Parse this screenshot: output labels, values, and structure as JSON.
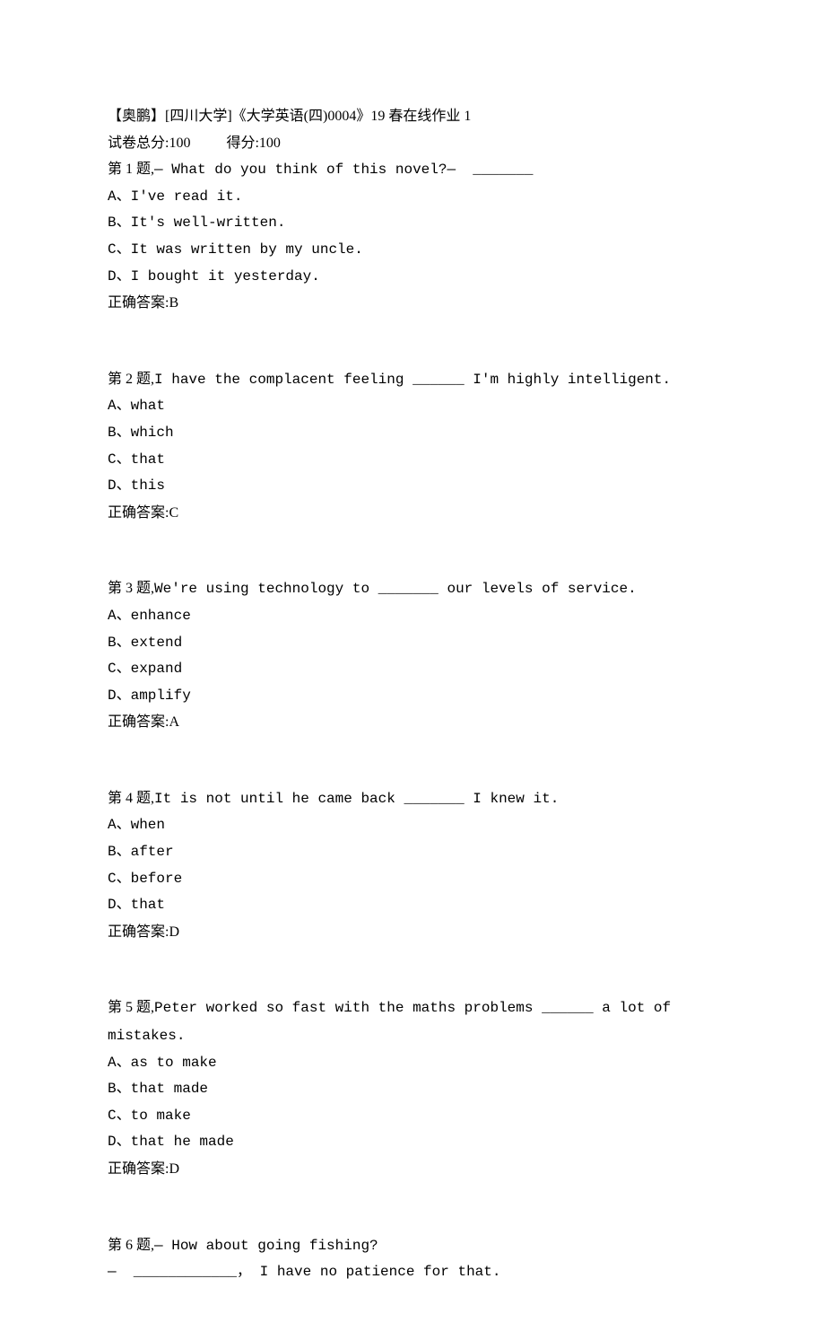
{
  "header": {
    "title": "【奥鹏】[四川大学]《大学英语(四)0004》19 春在线作业 1",
    "total_label": "试卷总分:",
    "total_value": "100",
    "score_label": "得分:",
    "score_value": "100"
  },
  "questions": [
    {
      "num": "第 1 题,",
      "text": "— What do you think of this novel?—  _______",
      "options": [
        "A、I've read it.",
        "B、It's well-written.",
        "C、It was written by my uncle.",
        "D、I bought it yesterday."
      ],
      "answer_label": "正确答案:",
      "answer": "B"
    },
    {
      "num": "第 2 题,",
      "text": "I have the complacent feeling ______ I'm highly intelligent.",
      "options": [
        "A、what",
        "B、which",
        "C、that",
        "D、this"
      ],
      "answer_label": "正确答案:",
      "answer": "C"
    },
    {
      "num": "第 3 题,",
      "text": "We're using technology to _______ our levels of service.",
      "options": [
        "A、enhance",
        "B、extend",
        "C、expand",
        "D、amplify"
      ],
      "answer_label": "正确答案:",
      "answer": "A"
    },
    {
      "num": "第 4 题,",
      "text": "It is not until he came back _______ I knew it.",
      "options": [
        "A、when",
        "B、after",
        "C、before",
        "D、that"
      ],
      "answer_label": "正确答案:",
      "answer": "D"
    },
    {
      "num": "第 5 题,",
      "text": "Peter worked so fast with the maths problems ______ a lot of mistakes.",
      "options": [
        "A、as to make",
        "B、that made",
        "C、to make",
        "D、that he made"
      ],
      "answer_label": "正确答案:",
      "answer": "D"
    },
    {
      "num": "第 6 题,",
      "text": "— How about going fishing?",
      "text2": "—  ____________， I have no patience for that.",
      "options": [],
      "answer_label": "",
      "answer": ""
    }
  ]
}
